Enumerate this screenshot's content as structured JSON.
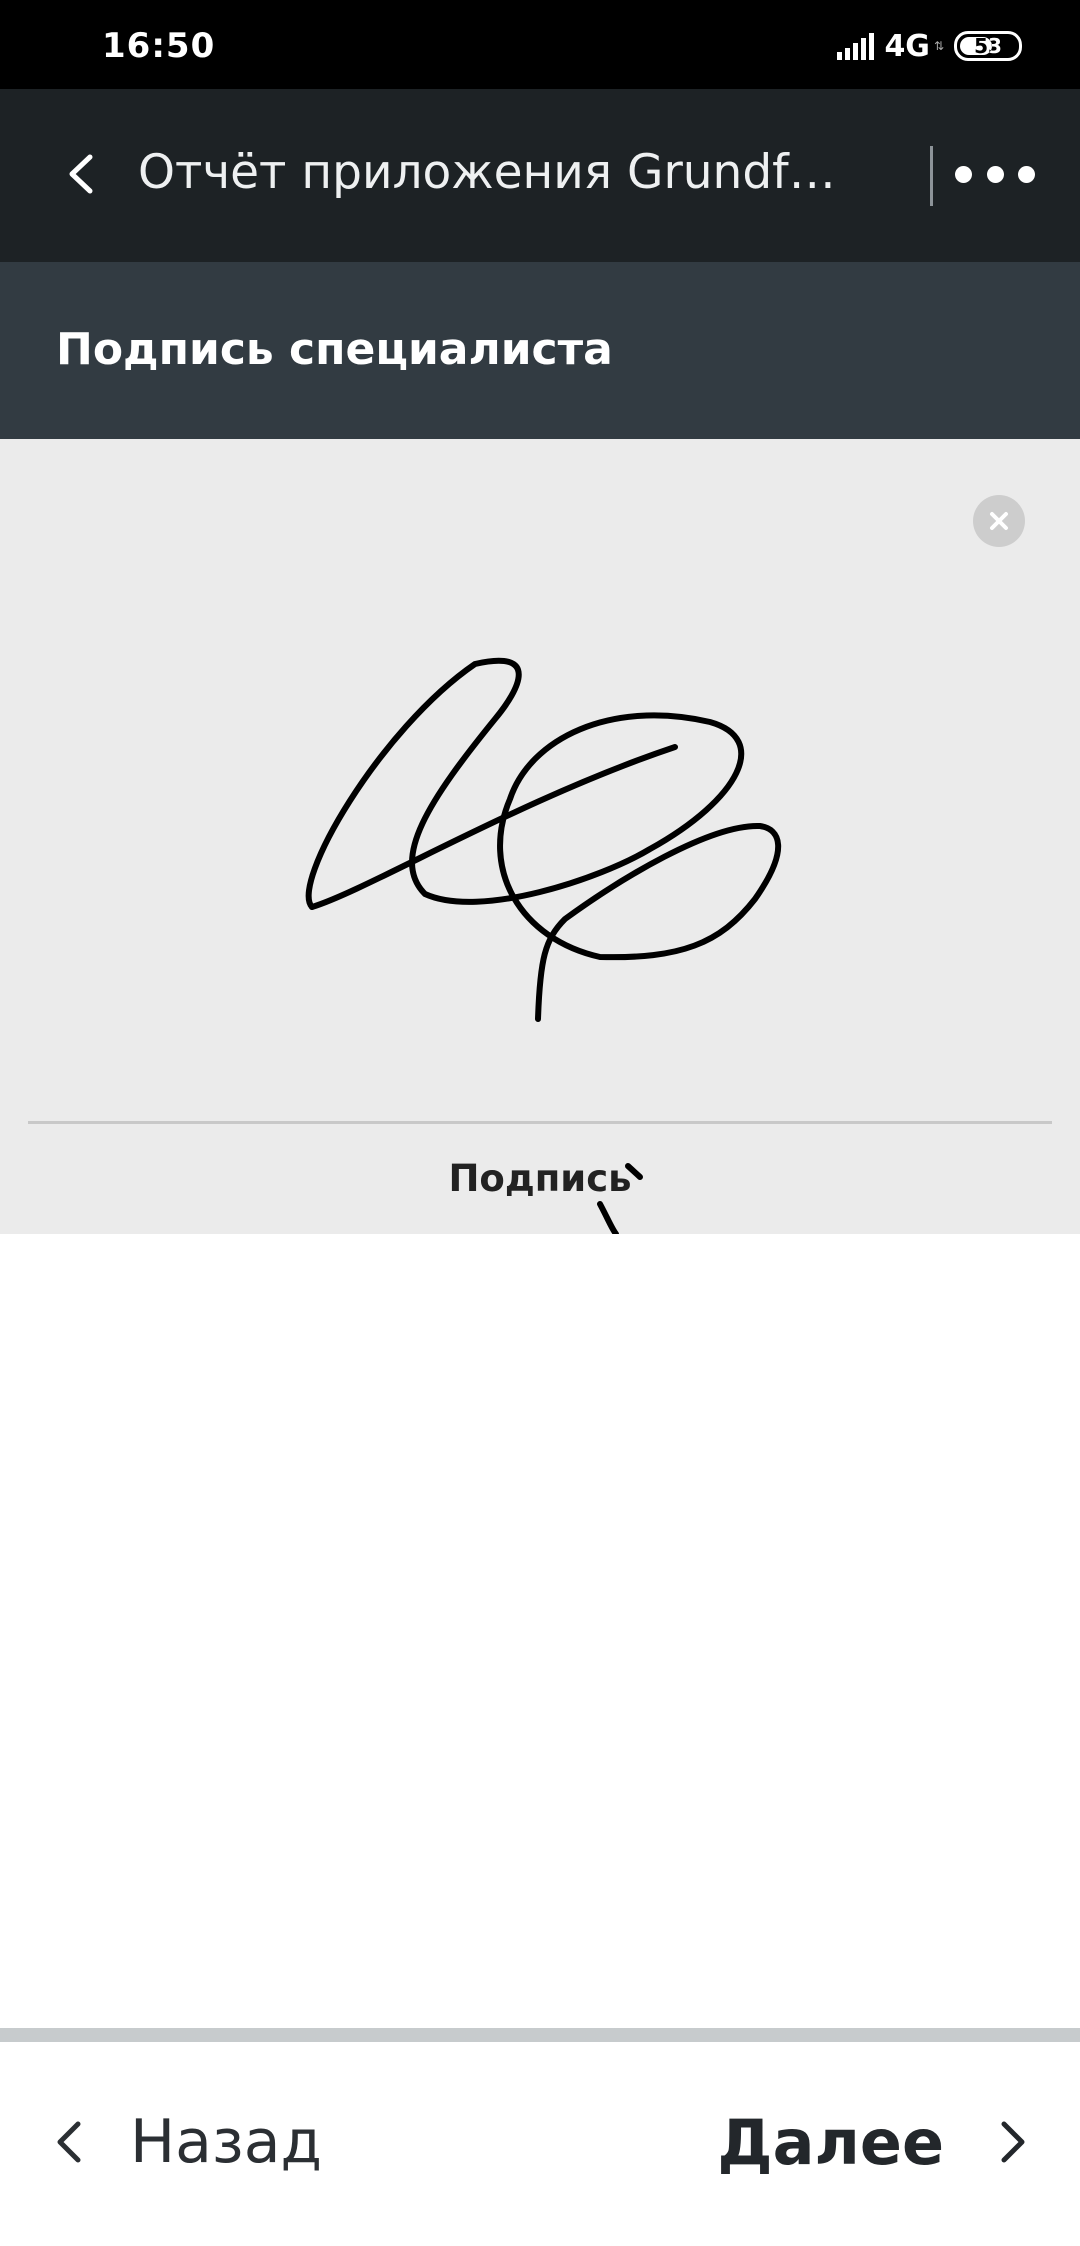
{
  "status_bar": {
    "time": "16:50",
    "network": "4G",
    "battery": "53"
  },
  "header": {
    "title": "Отчёт приложения Grundfos G..."
  },
  "section": {
    "title": "Подпись специалиста"
  },
  "signature_pad": {
    "label": "Подпись"
  },
  "nav": {
    "back_label": "Назад",
    "next_label": "Далее"
  },
  "icons": {
    "back": "chevron-left-icon",
    "more": "more-horizontal-icon",
    "clear": "close-icon",
    "nav_back": "chevron-left-icon",
    "nav_next": "chevron-right-icon"
  },
  "colors": {
    "header_bg": "#1d2225",
    "section_bg": "#323b42",
    "pad_bg": "#ebebeb"
  }
}
